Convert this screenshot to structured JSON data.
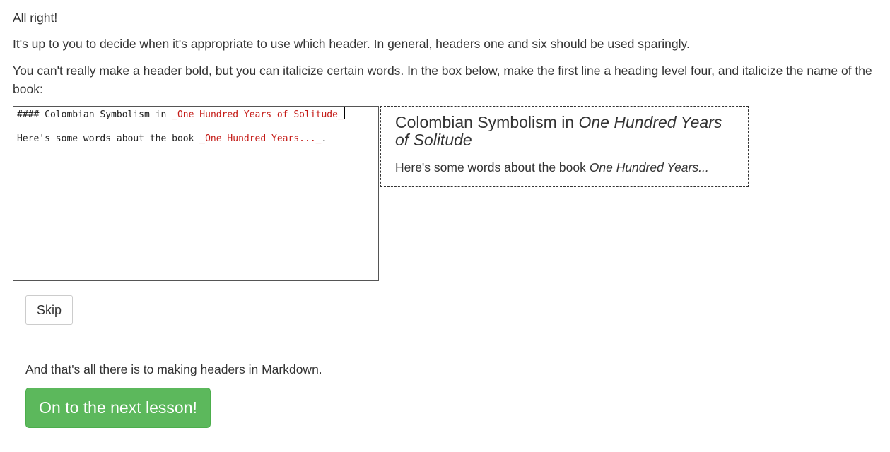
{
  "intro": {
    "p1": "All right!",
    "p2": "It's up to you to decide when it's appropriate to use which header. In general, headers one and six should be used sparingly.",
    "p3": "You can't really make a header bold, but you can italicize certain words. In the box below, make the first line a heading level four, and italicize the name of the book:"
  },
  "editor": {
    "line1_prefix": "#### Colombian Symbolism in ",
    "line1_em": "_One Hundred Years of Solitude_",
    "line2_prefix": "Here's some words about the book ",
    "line2_em": "_One Hundred Years..._",
    "line2_suffix": "."
  },
  "preview": {
    "heading_prefix": "Colombian Symbolism in ",
    "heading_em": "One Hundred Years of Solitude",
    "body_prefix": "Here's some words about the book ",
    "body_em": "One Hundred Years..."
  },
  "buttons": {
    "skip": "Skip",
    "next": "On to the next lesson!"
  },
  "outro": "And that's all there is to making headers in Markdown.",
  "colors": {
    "next_button": "#5cb85c",
    "markdown_emphasis": "#c41a16"
  }
}
